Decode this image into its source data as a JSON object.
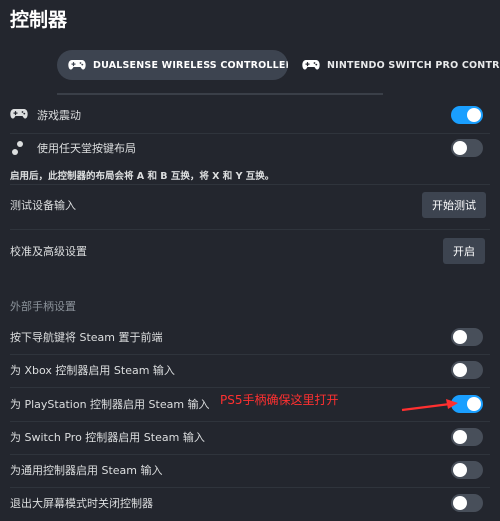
{
  "page": {
    "title": "控制器"
  },
  "tabs": [
    {
      "label": "DUALSENSE WIRELESS CONTROLLER",
      "icon": "gamepad-icon",
      "active": true
    },
    {
      "label": "NINTENDO SWITCH PRO CONTROLLER",
      "icon": "gamepad-icon",
      "active": false
    }
  ],
  "settings": {
    "vibration": {
      "label": "游戏震动",
      "icon": "gamepad-icon",
      "on": true
    },
    "nintendo_layout": {
      "label": "使用任天堂按键布局",
      "icon": "buttons-icon",
      "on": false
    },
    "layout_note": "启用后，此控制器的布局会将 A 和 B 互换，将 X 和 Y 互换。",
    "test_input": {
      "label": "测试设备输入",
      "button": "开始测试"
    },
    "calibration": {
      "label": "校准及高级设置",
      "button": "开启"
    }
  },
  "external": {
    "section_title": "外部手柄设置",
    "items": [
      {
        "label": "按下导航键将 Steam 置于前端",
        "on": false
      },
      {
        "label": "为 Xbox 控制器启用 Steam 输入",
        "on": false
      },
      {
        "label": "为 PlayStation 控制器启用 Steam 输入",
        "on": true
      },
      {
        "label": "为 Switch Pro 控制器启用 Steam 输入",
        "on": false
      },
      {
        "label": "为通用控制器启用 Steam 输入",
        "on": false
      },
      {
        "label": "退出大屏幕模式时关闭控制器",
        "on": false
      }
    ]
  },
  "annotation": {
    "text": "PS5手柄确保这里打开",
    "color": "#ff3030"
  },
  "colors": {
    "accent": "#1a9fff",
    "background": "#23262e",
    "button": "#3d4450"
  }
}
